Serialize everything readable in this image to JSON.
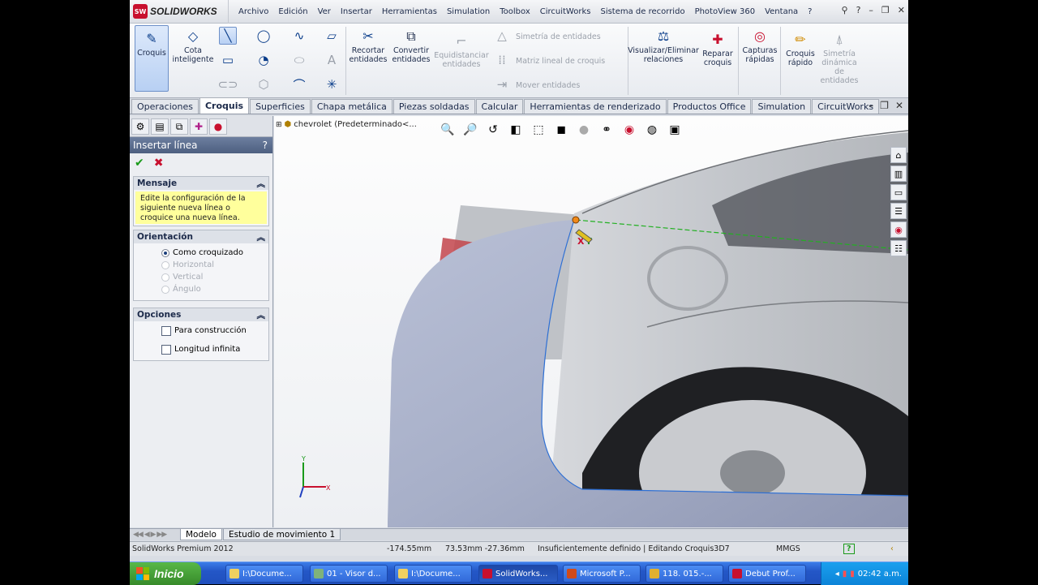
{
  "app": {
    "logo_text": "SOLIDWORKS",
    "logo_badge": "SW"
  },
  "menu": [
    "Archivo",
    "Edición",
    "Ver",
    "Insertar",
    "Herramientas",
    "Simulation",
    "Toolbox",
    "CircuitWorks",
    "Sistema de recorrido",
    "PhotoView 360",
    "Ventana",
    "?"
  ],
  "ribbon": {
    "croquis": "Croquis",
    "cota": "Cota inteligente",
    "recortar": "Recortar entidades",
    "convertir": "Convertir entidades",
    "equidistanciar": "Equidistanciar entidades",
    "simetria": "Simetría de entidades",
    "matriz": "Matriz lineal de croquis",
    "mover": "Mover entidades",
    "visualizar": "Visualizar/Eliminar relaciones",
    "reparar": "Reparar croquis",
    "capturas": "Capturas rápidas",
    "croquis_rapido": "Croquis rápido",
    "simetria_dinamica": "Simetría dinámica de entidades"
  },
  "tabs": [
    "Operaciones",
    "Croquis",
    "Superficies",
    "Chapa metálica",
    "Piezas soldadas",
    "Calcular",
    "Herramientas de renderizado",
    "Productos Office",
    "Simulation",
    "CircuitWorks"
  ],
  "active_tab": "Croquis",
  "property_manager": {
    "title": "Insertar línea",
    "help": "?",
    "mensaje_title": "Mensaje",
    "mensaje_text": "Edite la configuración de la siguiente nueva línea o croquice una nueva línea.",
    "orientacion_title": "Orientación",
    "orientacion_options": [
      "Como croquizado",
      "Horizontal",
      "Vertical",
      "Ángulo"
    ],
    "orientacion_selected": "Como croquizado",
    "opciones_title": "Opciones",
    "opciones": [
      "Para construcción",
      "Longitud infinita"
    ]
  },
  "viewport": {
    "tree_label": "chevrolet  (Predeterminado<...",
    "axis_x": "X",
    "axis_y": "Y"
  },
  "bottom_tabs": [
    "Modelo",
    "Estudio de movimiento 1"
  ],
  "status": {
    "product": "SolidWorks Premium 2012",
    "x": "-174.55mm",
    "y": "73.53mm -27.36mm",
    "state": "Insuficientemente definido | Editando Croquis3D7",
    "units": "MMGS",
    "help": "?"
  },
  "taskbar": {
    "start": "Inicio",
    "items": [
      "I:\\Docume...",
      "01 - Visor d...",
      "I:\\Docume...",
      "SolidWorks...",
      "Microsoft P...",
      "118. 015.-...",
      "Debut Prof..."
    ],
    "clock": "02:42 a.m."
  },
  "colors": {
    "accent": "#6d7f9f",
    "taskbar": "#2457c7",
    "start": "#378a2a",
    "message": "#ffff9c"
  }
}
